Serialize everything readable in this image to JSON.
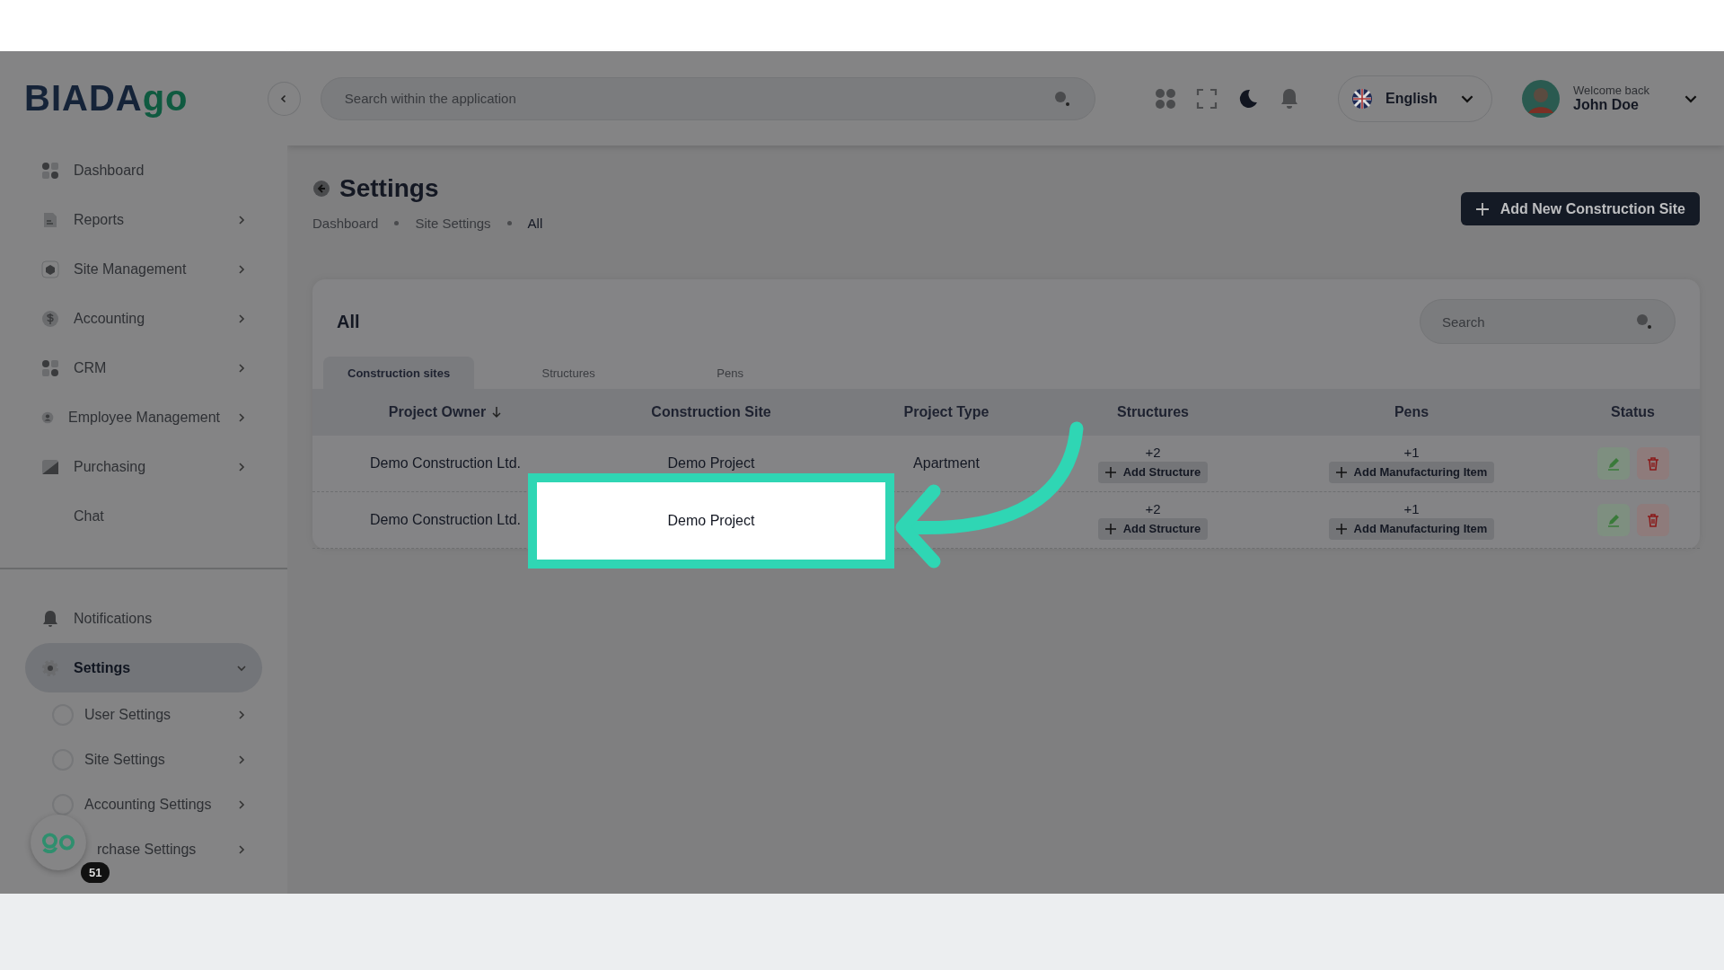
{
  "logo": {
    "text": "BIADA",
    "accent": "go"
  },
  "top_bar": {
    "search": {
      "placeholder": "Search within the application"
    },
    "language": "English",
    "user": {
      "greeting": "Welcome back",
      "name": "John Doe"
    }
  },
  "sidebar": {
    "items": [
      {
        "label": "Dashboard",
        "kind": "link",
        "selected": false
      },
      {
        "label": "Reports",
        "kind": "menu",
        "selected": false
      },
      {
        "label": "Site Management",
        "kind": "menu",
        "selected": false
      },
      {
        "label": "Accounting",
        "kind": "menu",
        "selected": false
      },
      {
        "label": "CRM",
        "kind": "menu",
        "selected": false
      },
      {
        "label": "Employee Management",
        "kind": "menu",
        "selected": false
      },
      {
        "label": "Purchasing",
        "kind": "menu",
        "selected": false
      },
      {
        "label": "Chat",
        "kind": "link",
        "selected": false
      }
    ],
    "bottom_items": [
      {
        "label": "Notifications",
        "kind": "link",
        "selected": false
      },
      {
        "label": "Settings",
        "kind": "menu",
        "selected": true,
        "expanded": true,
        "children": [
          {
            "label": "User Settings"
          },
          {
            "label": "Site Settings"
          },
          {
            "label": "Accounting Settings"
          },
          {
            "label": "rchase Settings"
          }
        ]
      }
    ],
    "help_bubble": {
      "badge": "51"
    }
  },
  "page": {
    "title": "Settings",
    "breadcrumb": [
      "Dashboard",
      "Site Settings",
      "All"
    ],
    "add_button": "Add New Construction Site"
  },
  "card": {
    "title": "All",
    "search": {
      "placeholder": "Search"
    },
    "tabs": [
      {
        "label": "Construction sites",
        "selected": true
      },
      {
        "label": "Structures",
        "selected": false
      },
      {
        "label": "Pens",
        "selected": false
      }
    ],
    "table": {
      "columns": [
        {
          "label": "Project Owner",
          "sorted": true
        },
        {
          "label": "Construction Site",
          "sorted": false
        },
        {
          "label": "Project Type",
          "sorted": false
        },
        {
          "label": "Structures",
          "sorted": false
        },
        {
          "label": "Pens",
          "sorted": false
        },
        {
          "label": "Status",
          "sorted": false
        }
      ],
      "rows": [
        {
          "owner": "Demo Construction Ltd.",
          "site": "Demo Project",
          "type": "Apartment",
          "structures": {
            "count": "+2",
            "button": "Add Structure"
          },
          "pens": {
            "count": "+1",
            "button": "Add Manufacturing Item"
          },
          "highlighted": false
        },
        {
          "owner": "Demo Construction Ltd.",
          "site": "Demo Project",
          "structures": {
            "count": "+2",
            "button": "Add Structure"
          },
          "pens": {
            "count": "+1",
            "button": "Add Manufacturing Item"
          },
          "highlighted": true
        }
      ]
    }
  }
}
